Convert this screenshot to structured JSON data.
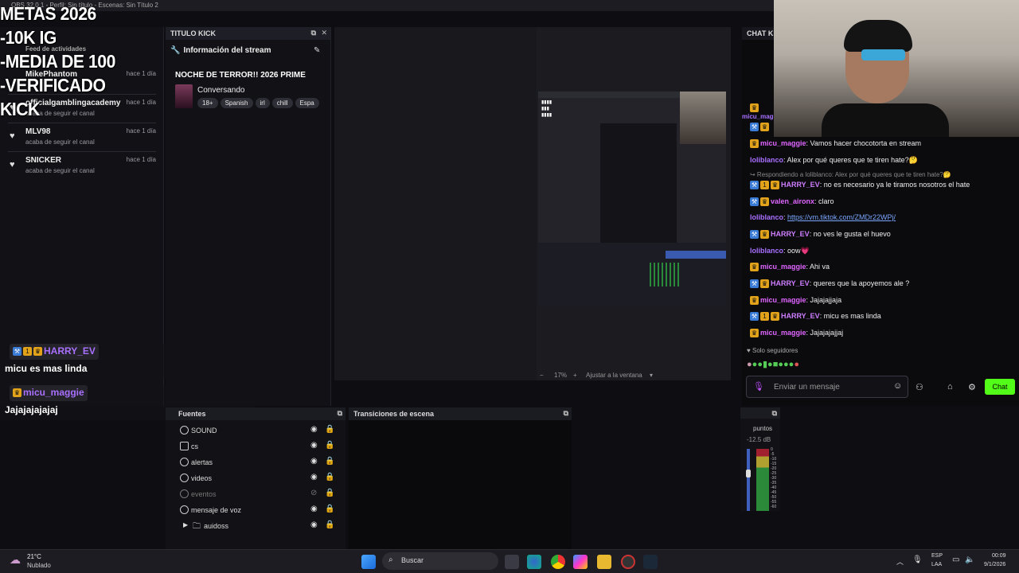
{
  "window": {
    "title": "OBS 32.0.1 - Perfil: Sin título - Escenas: Sin Título 2"
  },
  "overlay_goals": [
    "METAS 2026",
    "-10K IG",
    "-MEDIA DE 100",
    "-VERIFICADO KICK"
  ],
  "activity": {
    "title": "Feed de actividades",
    "items": [
      {
        "name": "MikePhantom",
        "ago": "hace 1 día",
        "sub": ""
      },
      {
        "name": "officialgamblingacademy",
        "ago": "hace 1 día",
        "sub": "acaba de seguir el canal"
      },
      {
        "name": "MLV98",
        "ago": "hace 1 día",
        "sub": "acaba de seguir el canal"
      },
      {
        "name": "SNICKER",
        "ago": "hace 1 día",
        "sub": "acaba de seguir el canal"
      }
    ]
  },
  "titulo_dock": {
    "header": "TITULO KICK",
    "section": "Información del stream",
    "stream_title": "NOCHE DE TERROR!! 2026 PRIME",
    "category": "Conversando",
    "tags": [
      "18+",
      "Spanish",
      "irl",
      "chill",
      "Espa"
    ]
  },
  "preview": {
    "zoom": "17%",
    "fit_label": "Ajustar a la ventana",
    "minus": "−",
    "plus": "+"
  },
  "chat_dock": {
    "header": "CHAT KI",
    "messages": [
      {
        "user": "micu_maggie",
        "text": "Vamos hacer chocotorta en stream",
        "style": "pink",
        "badges": "crown"
      },
      {
        "user": "loliblanco",
        "text": "Alex por qué queres que te tiren hate?🤔",
        "style": "purple",
        "badges": ""
      },
      {
        "user": "HARRY_EV",
        "text": "no es necesario ya le tiramos nosotros el hate",
        "style": "cyan",
        "badges": "all",
        "reply": "↪ Respondiendo a loliblanco: Alex por qué queres que te tiren hate?🤔"
      },
      {
        "user": "valen_aironx",
        "text": "claro",
        "style": "pink",
        "badges": "two"
      },
      {
        "user": "loliblanco",
        "text": "",
        "style": "purple",
        "badges": "",
        "link": "https://vm.tiktok.com/ZMDr22WPj/"
      },
      {
        "user": "HARRY_EV",
        "text": "no ves le gusta el huevo",
        "style": "cyan",
        "badges": "all"
      },
      {
        "user": "loliblanco",
        "text": "oow💗",
        "style": "purple",
        "badges": ""
      },
      {
        "user": "micu_maggie",
        "text": "Ahi va",
        "style": "pink",
        "badges": "crown"
      },
      {
        "user": "HARRY_EV",
        "text": "queres que la apoyemos ale ?",
        "style": "cyan",
        "badges": "all"
      },
      {
        "user": "micu_maggie",
        "text": "Jajajajjaja",
        "style": "pink",
        "badges": "crown"
      },
      {
        "user": "HARRY_EV",
        "text": "micu es mas linda",
        "style": "cyan",
        "badges": "all"
      },
      {
        "user": "micu_maggie",
        "text": "Jajajajajjaj",
        "style": "pink",
        "badges": "crown"
      }
    ],
    "followers_only": "Solo seguidores",
    "input_placeholder": "Enviar un mensaje",
    "send_label": "Chat"
  },
  "overlay_chat": [
    {
      "user": "HARRY_EV",
      "text": "micu es mas linda"
    },
    {
      "user": "micu_maggie",
      "text": "Jajajajajajaj"
    }
  ],
  "fuentes": {
    "header": "Fuentes",
    "items": [
      {
        "label": "SOUND",
        "hidden": false
      },
      {
        "label": "cs",
        "hidden": false
      },
      {
        "label": "alertas",
        "hidden": false
      },
      {
        "label": "videos",
        "hidden": false
      },
      {
        "label": "eventos",
        "hidden": true
      },
      {
        "label": "mensaje de voz",
        "hidden": false
      },
      {
        "label": "auidoss",
        "hidden": false
      }
    ]
  },
  "transiciones": {
    "header": "Transiciones de escena"
  },
  "audio": {
    "label": "puntos",
    "db": "-12.5 dB",
    "scale": [
      "0",
      "-5",
      "-10",
      "-15",
      "-20",
      "-25",
      "-30",
      "-35",
      "-40",
      "-45",
      "-50",
      "-55",
      "-60"
    ]
  },
  "taskbar": {
    "weather_temp": "21°C",
    "weather_desc": "Nublado",
    "search_label": "Buscar",
    "lang1": "ESP",
    "lang2": "LAA",
    "time": "00:09",
    "date": "9/1/2026"
  }
}
